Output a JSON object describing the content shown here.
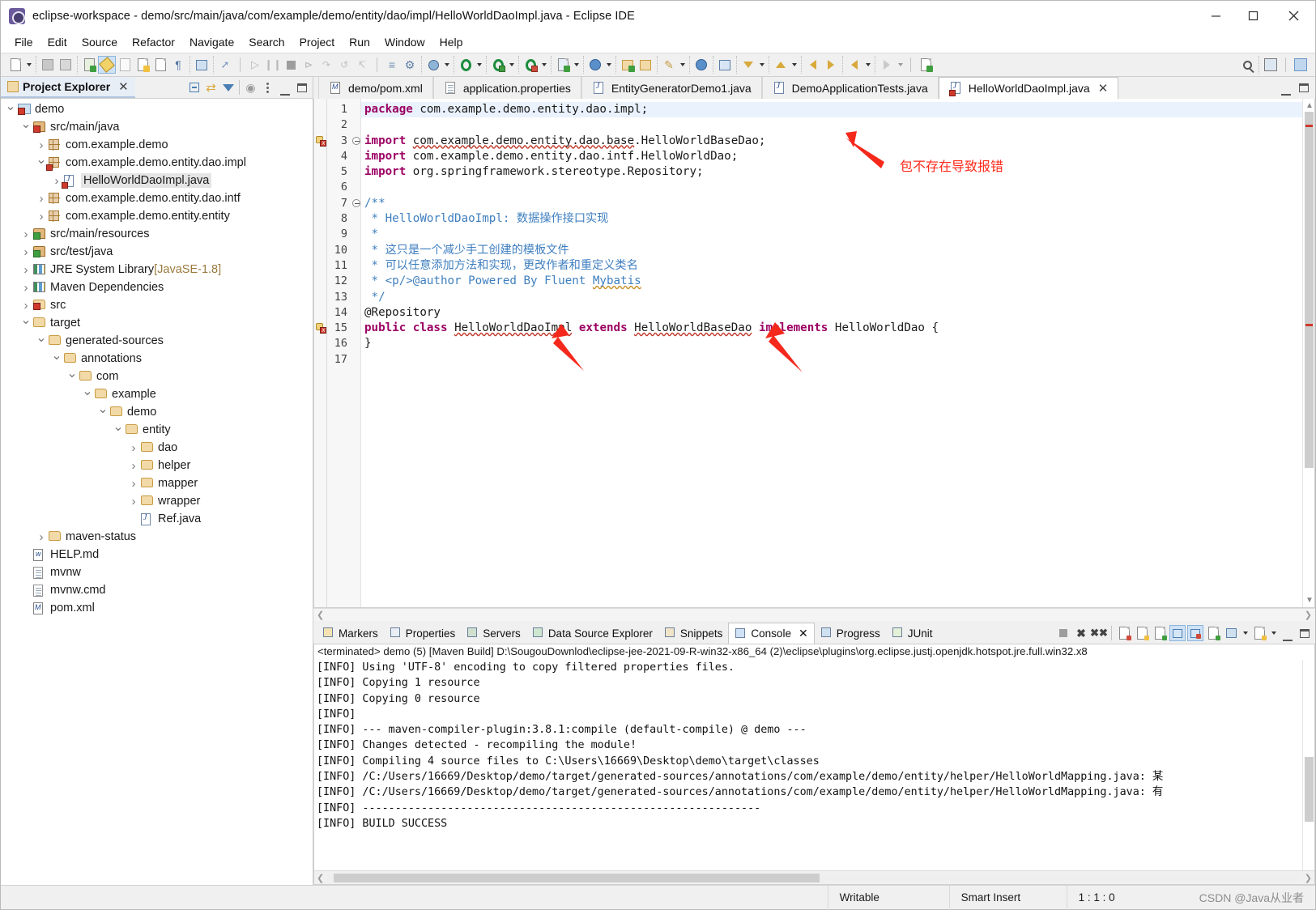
{
  "window": {
    "title": "eclipse-workspace - demo/src/main/java/com/example/demo/entity/dao/impl/HelloWorldDaoImpl.java - Eclipse IDE",
    "app_icon": "eclipse-icon",
    "minimize": "─",
    "maximize": "☐",
    "close": "✕"
  },
  "menubar": {
    "items": [
      "File",
      "Edit",
      "Source",
      "Refactor",
      "Navigate",
      "Search",
      "Project",
      "Run",
      "Window",
      "Help"
    ]
  },
  "project_explorer": {
    "title": "Project Explorer",
    "close_label": "✕",
    "tools": [
      "collapse-all-icon",
      "link-with-editor-icon",
      "view-filter-icon",
      "focus-icon",
      "view-menu-icon",
      "minimize-icon",
      "maximize-icon"
    ],
    "tree": [
      {
        "depth": 0,
        "twisty": "open",
        "icon": "project-error-icon",
        "label": "demo"
      },
      {
        "depth": 1,
        "twisty": "open",
        "icon": "source-folder-error-icon",
        "label": "src/main/java"
      },
      {
        "depth": 2,
        "twisty": "closed",
        "icon": "package-icon",
        "label": "com.example.demo"
      },
      {
        "depth": 2,
        "twisty": "open",
        "icon": "package-error-icon",
        "label": "com.example.demo.entity.dao.impl"
      },
      {
        "depth": 3,
        "twisty": "closed",
        "icon": "java-file-error-icon",
        "label": "HelloWorldDaoImpl.java",
        "selected": true
      },
      {
        "depth": 2,
        "twisty": "closed",
        "icon": "package-icon",
        "label": "com.example.demo.entity.dao.intf"
      },
      {
        "depth": 2,
        "twisty": "closed",
        "icon": "package-icon",
        "label": "com.example.demo.entity.entity"
      },
      {
        "depth": 1,
        "twisty": "closed",
        "icon": "source-folder-icon",
        "label": "src/main/resources"
      },
      {
        "depth": 1,
        "twisty": "closed",
        "icon": "source-folder-icon",
        "label": "src/test/java"
      },
      {
        "depth": 1,
        "twisty": "closed",
        "icon": "library-icon",
        "label": "JRE System Library",
        "suffix": "[JavaSE-1.8]"
      },
      {
        "depth": 1,
        "twisty": "closed",
        "icon": "library-icon",
        "label": "Maven Dependencies"
      },
      {
        "depth": 1,
        "twisty": "closed",
        "icon": "folder-error-icon",
        "label": "src"
      },
      {
        "depth": 1,
        "twisty": "open",
        "icon": "folder-icon",
        "label": "target"
      },
      {
        "depth": 2,
        "twisty": "open",
        "icon": "folder-icon",
        "label": "generated-sources"
      },
      {
        "depth": 3,
        "twisty": "open",
        "icon": "folder-icon",
        "label": "annotations"
      },
      {
        "depth": 4,
        "twisty": "open",
        "icon": "folder-icon",
        "label": "com"
      },
      {
        "depth": 5,
        "twisty": "open",
        "icon": "folder-icon",
        "label": "example"
      },
      {
        "depth": 6,
        "twisty": "open",
        "icon": "folder-icon",
        "label": "demo"
      },
      {
        "depth": 7,
        "twisty": "open",
        "icon": "folder-icon",
        "label": "entity"
      },
      {
        "depth": 8,
        "twisty": "closed",
        "icon": "folder-icon",
        "label": "dao"
      },
      {
        "depth": 8,
        "twisty": "closed",
        "icon": "folder-icon",
        "label": "helper"
      },
      {
        "depth": 8,
        "twisty": "closed",
        "icon": "folder-icon",
        "label": "mapper"
      },
      {
        "depth": 8,
        "twisty": "closed",
        "icon": "folder-icon",
        "label": "wrapper"
      },
      {
        "depth": 8,
        "twisty": "none",
        "icon": "java-file-icon",
        "label": "Ref.java"
      },
      {
        "depth": 2,
        "twisty": "closed",
        "icon": "folder-icon",
        "label": "maven-status"
      },
      {
        "depth": 1,
        "twisty": "none",
        "icon": "markdown-file-icon",
        "label": "HELP.md"
      },
      {
        "depth": 1,
        "twisty": "none",
        "icon": "text-file-icon",
        "label": "mvnw"
      },
      {
        "depth": 1,
        "twisty": "none",
        "icon": "text-file-icon",
        "label": "mvnw.cmd"
      },
      {
        "depth": 1,
        "twisty": "none",
        "icon": "xml-file-icon",
        "label": "pom.xml"
      }
    ]
  },
  "editor": {
    "tabs": [
      {
        "label": "demo/pom.xml",
        "icon": "maven-file-icon",
        "active": false
      },
      {
        "label": "application.properties",
        "icon": "properties-file-icon",
        "active": false
      },
      {
        "label": "EntityGeneratorDemo1.java",
        "icon": "java-file-icon",
        "active": false
      },
      {
        "label": "DemoApplicationTests.java",
        "icon": "java-file-icon",
        "active": false
      },
      {
        "label": "HelloWorldDaoImpl.java",
        "icon": "java-file-error-icon",
        "active": true,
        "close": "✕"
      }
    ],
    "line_numbers": [
      "1",
      "2",
      "3",
      "4",
      "5",
      "6",
      "7",
      "8",
      "9",
      "10",
      "11",
      "12",
      "13",
      "14",
      "15",
      "16",
      "17"
    ],
    "lines": [
      {
        "n": 1,
        "segments": [
          {
            "t": "package",
            "c": "kw"
          },
          {
            "t": " com.example.demo.entity.dao.impl;",
            "c": ""
          }
        ],
        "highlight": true
      },
      {
        "n": 2,
        "segments": []
      },
      {
        "n": 3,
        "segments": [
          {
            "t": "import",
            "c": "kw"
          },
          {
            "t": " ",
            "c": ""
          },
          {
            "t": "com.example.demo.entity.dao.base",
            "c": "err-u"
          },
          {
            "t": ".HelloWorldBaseDao;",
            "c": ""
          }
        ],
        "fold": true,
        "error": true
      },
      {
        "n": 4,
        "segments": [
          {
            "t": "import",
            "c": "kw"
          },
          {
            "t": " com.example.demo.entity.dao.intf.HelloWorldDao;",
            "c": ""
          }
        ]
      },
      {
        "n": 5,
        "segments": [
          {
            "t": "import",
            "c": "kw"
          },
          {
            "t": " org.springframework.stereotype.Repository;",
            "c": ""
          }
        ]
      },
      {
        "n": 6,
        "segments": []
      },
      {
        "n": 7,
        "segments": [
          {
            "t": "/**",
            "c": "cm"
          }
        ],
        "fold": true
      },
      {
        "n": 8,
        "segments": [
          {
            "t": " * HelloWorldDaoImpl: 数据操作接口实现",
            "c": "cm"
          }
        ]
      },
      {
        "n": 9,
        "segments": [
          {
            "t": " *",
            "c": "cm"
          }
        ]
      },
      {
        "n": 10,
        "segments": [
          {
            "t": " * 这只是一个减少手工创建的模板文件",
            "c": "cm"
          }
        ]
      },
      {
        "n": 11,
        "segments": [
          {
            "t": " * 可以任意添加方法和实现，更改作者和重定义类名",
            "c": "cm"
          }
        ]
      },
      {
        "n": 12,
        "segments": [
          {
            "t": " * <p/>@author Powered By Fluent ",
            "c": "cm"
          },
          {
            "t": "Mybatis",
            "c": "cm warn-u"
          }
        ]
      },
      {
        "n": 13,
        "segments": [
          {
            "t": " */",
            "c": "cm"
          }
        ]
      },
      {
        "n": 14,
        "segments": [
          {
            "t": "@Repository",
            "c": "an"
          }
        ]
      },
      {
        "n": 15,
        "segments": [
          {
            "t": "public",
            "c": "kw"
          },
          {
            "t": " ",
            "c": ""
          },
          {
            "t": "class",
            "c": "kw"
          },
          {
            "t": " ",
            "c": ""
          },
          {
            "t": "HelloWorldDaoImpl",
            "c": "err-u"
          },
          {
            "t": " ",
            "c": ""
          },
          {
            "t": "extends",
            "c": "kw"
          },
          {
            "t": " ",
            "c": ""
          },
          {
            "t": "HelloWorldBaseDao",
            "c": "err-u"
          },
          {
            "t": " ",
            "c": ""
          },
          {
            "t": "implements",
            "c": "kw"
          },
          {
            "t": " HelloWorldDao {",
            "c": ""
          }
        ],
        "error": true
      },
      {
        "n": 16,
        "segments": [
          {
            "t": "}",
            "c": ""
          }
        ]
      },
      {
        "n": 17,
        "segments": []
      }
    ],
    "annotations": [
      {
        "name": "import-error-note",
        "text": "包不存在导致报错",
        "color": "#ff2a19"
      }
    ]
  },
  "bottom_panel": {
    "tabs": [
      {
        "label": "Markers",
        "icon": "markers-icon",
        "active": false
      },
      {
        "label": "Properties",
        "icon": "properties-icon",
        "active": false
      },
      {
        "label": "Servers",
        "icon": "servers-icon",
        "active": false
      },
      {
        "label": "Data Source Explorer",
        "icon": "data-source-icon",
        "active": false
      },
      {
        "label": "Snippets",
        "icon": "snippets-icon",
        "active": false
      },
      {
        "label": "Console",
        "icon": "console-icon",
        "active": true,
        "close": "✕"
      },
      {
        "label": "Progress",
        "icon": "progress-icon",
        "active": false
      },
      {
        "label": "JUnit",
        "icon": "junit-icon",
        "active": false
      }
    ],
    "tools": [
      "terminate-icon",
      "remove-launch-icon",
      "remove-all-terminated-icon",
      "clear-console-icon",
      "scroll-lock-icon",
      "word-wrap-icon",
      "show-console-on-output-icon",
      "pin-console-icon",
      "new-console-view-icon",
      "display-selected-console-icon",
      "open-console-icon",
      "minimize-icon",
      "maximize-icon"
    ],
    "console_header": "<terminated> demo (5) [Maven Build] D:\\SougouDownlod\\eclipse-jee-2021-09-R-win32-x86_64 (2)\\eclipse\\plugins\\org.eclipse.justj.openjdk.hotspot.jre.full.win32.x8",
    "console_lines": [
      "[INFO] Using 'UTF-8' encoding to copy filtered properties files.",
      "[INFO] Copying 1 resource",
      "[INFO] Copying 0 resource",
      "[INFO]",
      "[INFO] --- maven-compiler-plugin:3.8.1:compile (default-compile) @ demo ---",
      "[INFO] Changes detected - recompiling the module!",
      "[INFO] Compiling 4 source files to C:\\Users\\16669\\Desktop\\demo\\target\\classes",
      "[INFO] /C:/Users/16669/Desktop/demo/target/generated-sources/annotations/com/example/demo/entity/helper/HelloWorldMapping.java: 某",
      "[INFO] /C:/Users/16669/Desktop/demo/target/generated-sources/annotations/com/example/demo/entity/helper/HelloWorldMapping.java: 有",
      "[INFO] -------------------------------------------------------------",
      "[INFO] BUILD SUCCESS"
    ]
  },
  "statusbar": {
    "writable": "Writable",
    "insert_mode": "Smart Insert",
    "position": "1 : 1 : 0",
    "watermark": "CSDN @Java从业者"
  }
}
